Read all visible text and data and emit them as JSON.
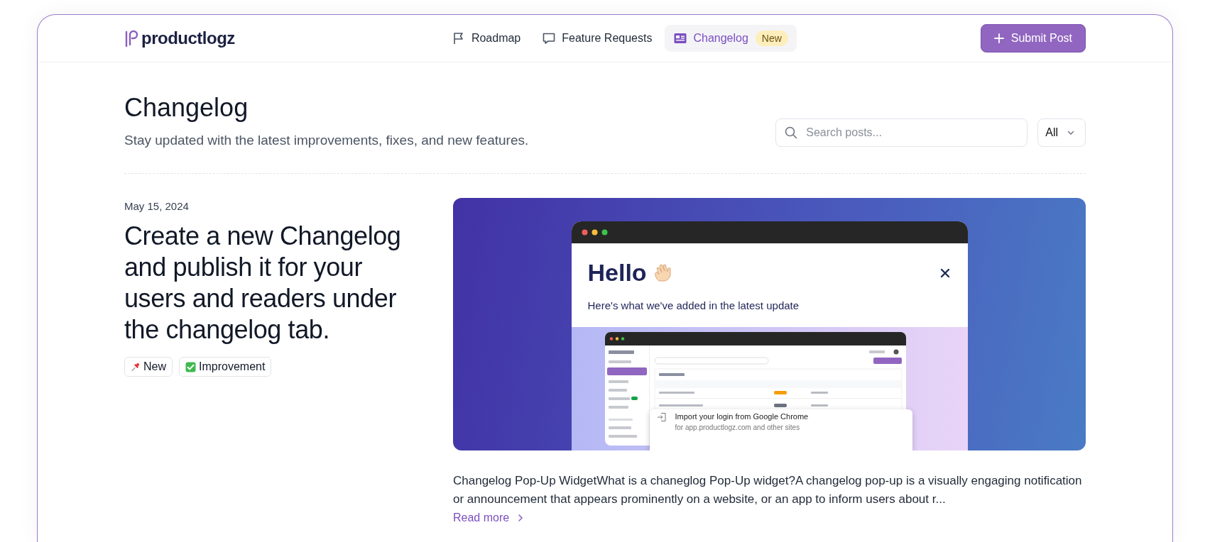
{
  "header": {
    "logo": "productlogz",
    "nav": [
      {
        "label": "Roadmap",
        "kind": "flag",
        "selected": false
      },
      {
        "label": "Feature Requests",
        "kind": "chat",
        "selected": false
      },
      {
        "label": "Changelog",
        "kind": "news",
        "selected": true,
        "badge": "New"
      }
    ],
    "submit_button": "Submit Post"
  },
  "page": {
    "title": "Changelog",
    "subtitle": "Stay updated with the latest improvements, fixes, and new features.",
    "search": {
      "placeholder": "Search posts..."
    },
    "filter": "All"
  },
  "posts": [
    {
      "date": "May 15, 2024",
      "title": "Create a new Changelog and publish it for your users and readers under the changelog tab.",
      "tags": [
        {
          "label": "New",
          "kind": "pin"
        },
        {
          "label": "Improvement",
          "kind": "check"
        }
      ],
      "preview": {
        "heading": "Hello",
        "subheading": "Here's what we've added in the latest update",
        "popup": {
          "title": "Import your login from Google Chrome",
          "subtitle": "for app.productlogz.com and other sites"
        }
      },
      "excerpt": "Changelog Pop-Up WidgetWhat is a chaneglog Pop-Up widget?A changelog pop-up is a visually engaging notification or announcement that appears prominently on a website, or an app to inform users about r...",
      "read_more": "Read more"
    }
  ]
}
